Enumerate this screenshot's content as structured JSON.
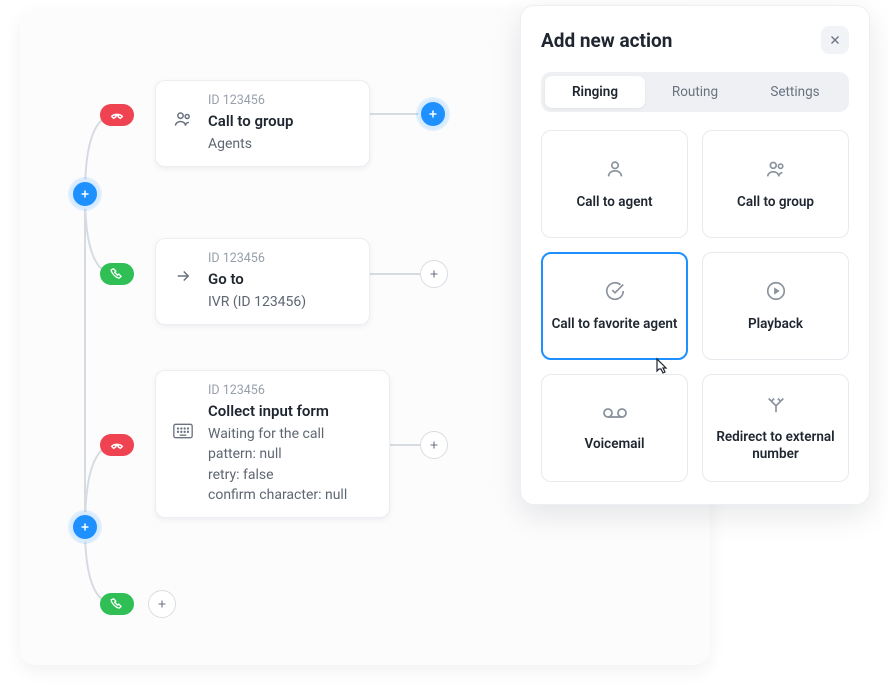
{
  "flow": {
    "node1": {
      "id": "ID 123456",
      "title": "Call to group",
      "sub": "Agents"
    },
    "node2": {
      "id": "ID 123456",
      "title": "Go to",
      "sub": "IVR (ID 123456)"
    },
    "node3": {
      "id": "ID 123456",
      "title": "Collect input form",
      "sub": "Waiting for the call\npattern: null\nretry: false\nconfirm character: null"
    }
  },
  "modal": {
    "title": "Add new action",
    "tabs": {
      "ringing": "Ringing",
      "routing": "Routing",
      "settings": "Settings"
    },
    "tiles": {
      "agent": "Call to agent",
      "group": "Call to group",
      "favorite": "Call to favorite agent",
      "playback": "Playback",
      "voicemail": "Voicemail",
      "redirect": "Redirect to external number"
    }
  }
}
